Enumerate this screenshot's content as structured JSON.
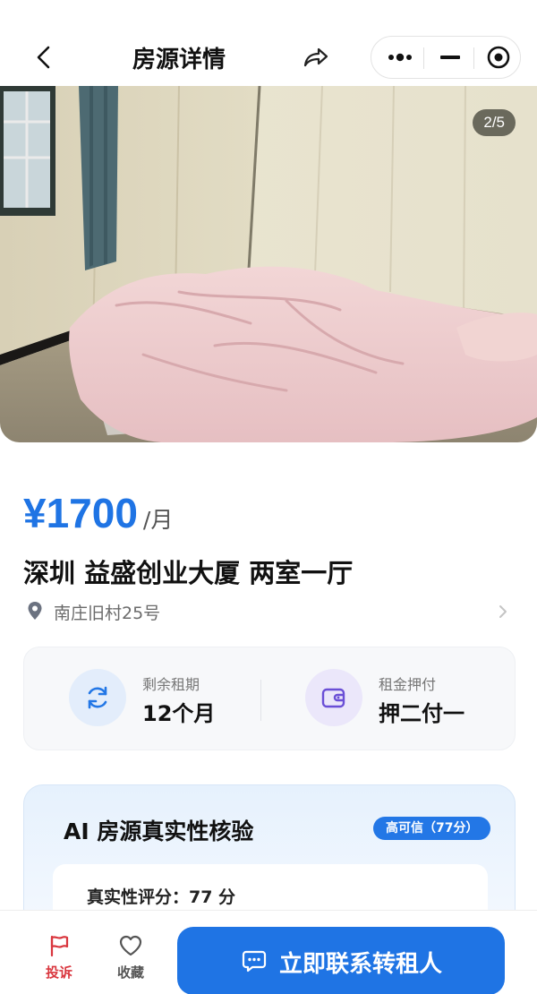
{
  "header": {
    "title": "房源详情",
    "back_icon": "chevron-left-icon",
    "share_icon": "share-arrow-icon",
    "capsule": {
      "more_icon": "more-dots-icon",
      "minimize_icon": "minimize-icon",
      "close_icon": "target-close-icon"
    }
  },
  "gallery": {
    "counter": "2/5"
  },
  "listing": {
    "price": "¥1700",
    "price_unit": "/月",
    "title": "深圳 益盛创业大厦 两室一厅",
    "address": "南庄旧村25号"
  },
  "stats": [
    {
      "icon": "refresh-cycle-icon",
      "label": "剩余租期",
      "value": "12个月"
    },
    {
      "icon": "wallet-icon",
      "label": "租金押付",
      "value": "押二付一"
    }
  ],
  "ai_check": {
    "title": "AI 房源真实性核验",
    "badge": "高可信（77分）",
    "score_text": "真实性评分：77 分"
  },
  "bottom_bar": {
    "report_label": "投诉",
    "favorite_label": "收藏",
    "contact_label": "立即联系转租人"
  },
  "colors": {
    "primary": "#1f74e4",
    "report_red": "#d9363e",
    "price": "#1f74e4"
  }
}
